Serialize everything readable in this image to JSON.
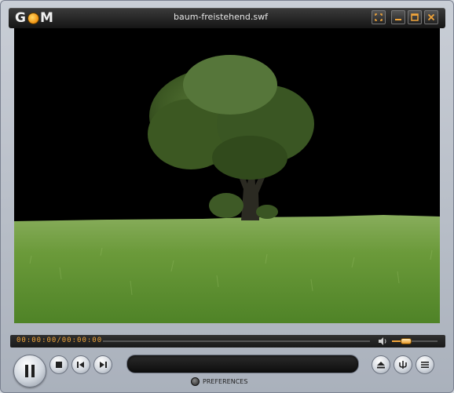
{
  "app": {
    "logo_text_before": "G",
    "logo_text_after": "M",
    "title": "baum-freistehend.swf"
  },
  "titlebar_buttons": [
    {
      "name": "fullscreen",
      "icon": "fullscreen-icon"
    },
    {
      "name": "minimize",
      "icon": "minimize-icon"
    },
    {
      "name": "maximize",
      "icon": "maximize-icon"
    },
    {
      "name": "close",
      "icon": "close-icon"
    }
  ],
  "seekbar": {
    "timecode": "00:00:00/00:00:00",
    "volume_level": 0.3
  },
  "controls": {
    "preferences_label": "PREFERENCES"
  },
  "colors": {
    "accent": "#f2a53a",
    "video_bg": "#000000",
    "grass": "#5e8f33",
    "tree_foliage": "#3e5a24"
  }
}
